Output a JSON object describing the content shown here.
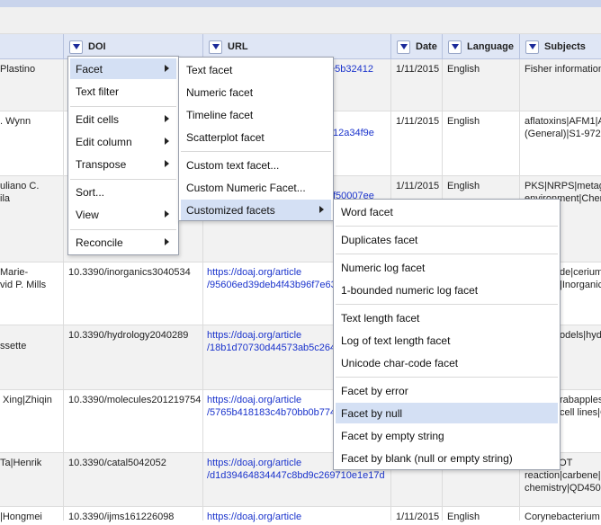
{
  "columns": [
    {
      "label": ""
    },
    {
      "label": "DOI"
    },
    {
      "label": "URL"
    },
    {
      "label": "Date"
    },
    {
      "label": "Language"
    },
    {
      "label": "Subjects"
    }
  ],
  "rows": [
    {
      "authors": "Plastino",
      "doi": "",
      "url1": "",
      "url2": "e5b32412",
      "date": "1/11/2015",
      "lang": "English",
      "subjects": "Fisher information"
    },
    {
      "authors": ". Wynn",
      "doi": "",
      "url1": "",
      "url2": "12a34f9e",
      "date": "1/11/2015",
      "lang": "English",
      "subjects": "aflatoxins|AFM1|A\n(General)|S1-972|"
    },
    {
      "authors": "uliano C.\nila",
      "doi": "",
      "url1": "",
      "url2": "f50007ee",
      "date": "1/11/2015",
      "lang": "English",
      "subjects": "PKS|NRPS|metage\nenvironment|Chem"
    },
    {
      "authors": "Marie-\nvid P. Mills",
      "doi": "10.3390/inorganics3040534",
      "url1": "https://doaj.org/article",
      "url2": "/95606ed39deb4f43b96f7e63",
      "date": "",
      "lang": "",
      "subjects": "de|cerium|\n|Inorganic"
    },
    {
      "authors": "ssette",
      "doi": "10.3390/hydrology2040289",
      "url1": "https://doaj.org/article",
      "url2": "/18b1d70730d44573ab5c264",
      "date": "",
      "lang": "",
      "subjects": "odels|hyd"
    },
    {
      "authors": " Xing|Zhiqin",
      "doi": "10.3390/molecules201219754",
      "url1": "https://doaj.org/article",
      "url2": "/5765b418183c4b70bb0b774",
      "date": "",
      "lang": "",
      "subjects": "rabapples\ncell lines|C"
    },
    {
      "authors": "Ta|Henrik",
      "doi": "10.3390/catal5042052",
      "url1": "https://doaj.org/article",
      "url2": "/d1d39464834447c8bd9c269710e1e17d",
      "date": "",
      "lang": "",
      "subjects": "id|NHC|OT\nreaction|carbene|c\nchemistry|QD450-"
    },
    {
      "authors": "|Hongmei",
      "doi": "10.3390/ijms161226098",
      "url1": "https://doaj.org/article",
      "url2": "",
      "date": "1/11/2015",
      "lang": "English",
      "subjects": "Corynebacterium"
    }
  ],
  "menu1": [
    "Facet",
    "Text filter",
    "Edit cells",
    "Edit column",
    "Transpose",
    "Sort...",
    "View",
    "Reconcile"
  ],
  "menu2": [
    "Text facet",
    "Numeric facet",
    "Timeline facet",
    "Scatterplot facet",
    "Custom text facet...",
    "Custom Numeric Facet...",
    "Customized facets"
  ],
  "menu3": [
    "Word facet",
    "Duplicates facet",
    "Numeric log facet",
    "1-bounded numeric log facet",
    "Text length facet",
    "Log of text length facet",
    "Unicode char-code facet",
    "Facet by error",
    "Facet by null",
    "Facet by empty string",
    "Facet by blank (null or empty string)"
  ],
  "colors": {
    "header": "#dfe6f5",
    "highlight": "#d4e0f4",
    "link": "#1a33cc"
  }
}
